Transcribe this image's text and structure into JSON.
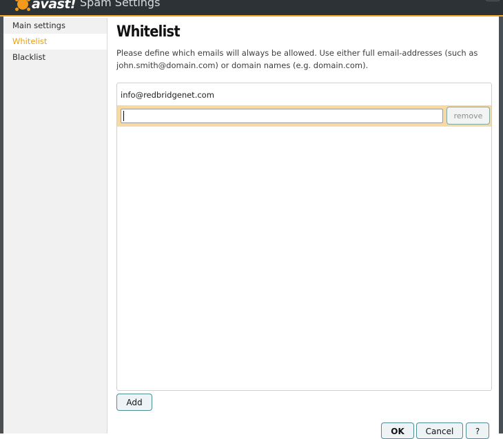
{
  "window": {
    "logo_text": "avast!",
    "title": "Spam Settings"
  },
  "sidebar": {
    "items": [
      {
        "label": "Main settings"
      },
      {
        "label": "Whitelist"
      },
      {
        "label": "Blacklist"
      }
    ]
  },
  "main": {
    "title": "Whitelist",
    "description": "Please define which emails will always be allowed. Use either full email-addresses (such as john.smith@domain.com) or domain names (e.g. domain.com).",
    "entries": [
      {
        "value": "info@redbridgenet.com"
      }
    ],
    "edit_entry": {
      "value": "",
      "remove_label": "remove"
    },
    "add_label": "Add"
  },
  "footer": {
    "ok_label": "OK",
    "cancel_label": "Cancel",
    "help_label": "?"
  },
  "colors": {
    "accent": "#f0a72b",
    "active_nav": "#e8a012",
    "edit_row": "#f7d9a4",
    "button_border": "#4d8d94"
  }
}
